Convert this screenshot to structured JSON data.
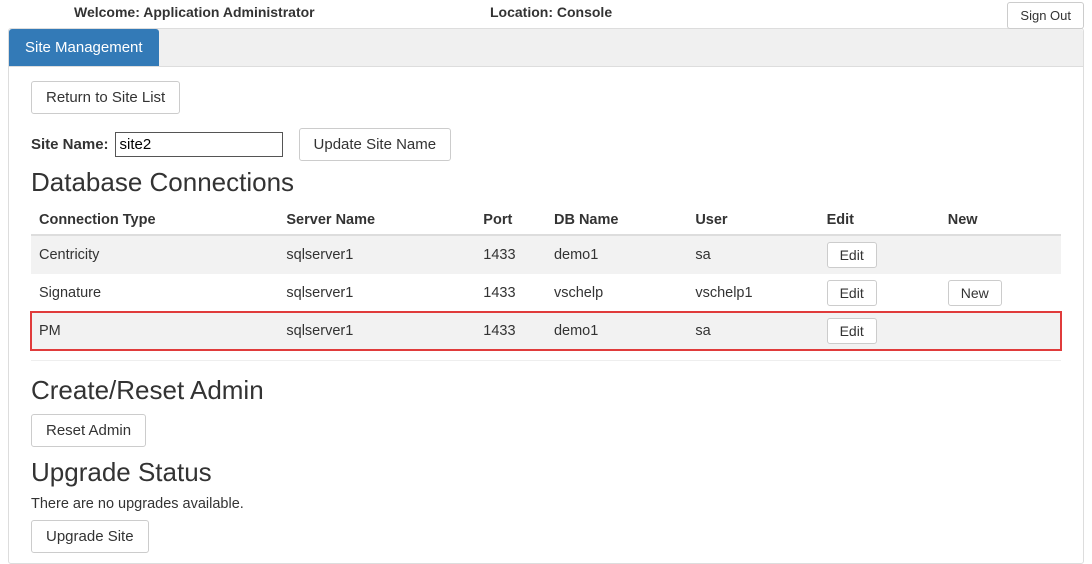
{
  "header": {
    "welcome": "Welcome: Application Administrator",
    "location": "Location: Console",
    "signout": "Sign Out"
  },
  "tab": {
    "site_management": "Site Management"
  },
  "actions": {
    "return_to_site_list": "Return to Site List",
    "update_site_name": "Update Site Name",
    "reset_admin": "Reset Admin",
    "upgrade_site": "Upgrade Site",
    "edit": "Edit",
    "new": "New"
  },
  "site": {
    "name_label": "Site Name:",
    "name_value": "site2"
  },
  "sections": {
    "db_connections": "Database Connections",
    "create_reset_admin": "Create/Reset Admin",
    "upgrade_status": "Upgrade Status"
  },
  "db_table": {
    "headers": {
      "type": "Connection Type",
      "server": "Server Name",
      "port": "Port",
      "db": "DB Name",
      "user": "User",
      "edit": "Edit",
      "new": "New"
    },
    "rows": [
      {
        "type": "Centricity",
        "server": "sqlserver1",
        "port": "1433",
        "db": "demo1",
        "user": "sa",
        "has_new": false,
        "striped": true,
        "highlight": false
      },
      {
        "type": "Signature",
        "server": "sqlserver1",
        "port": "1433",
        "db": "vschelp",
        "user": "vschelp1",
        "has_new": true,
        "striped": false,
        "highlight": false
      },
      {
        "type": "PM",
        "server": "sqlserver1",
        "port": "1433",
        "db": "demo1",
        "user": "sa",
        "has_new": false,
        "striped": true,
        "highlight": true
      }
    ]
  },
  "upgrade": {
    "status_text": "There are no upgrades available."
  }
}
